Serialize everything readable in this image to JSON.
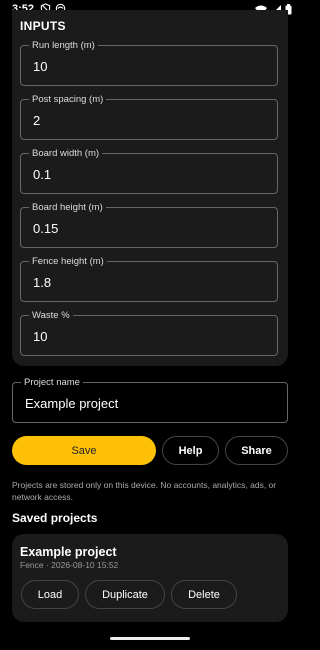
{
  "status_bar": {
    "time": "3:52"
  },
  "inputs": {
    "title": "INPUTS",
    "fields": [
      {
        "label": "Run length (m)",
        "value": "10"
      },
      {
        "label": "Post spacing (m)",
        "value": "2"
      },
      {
        "label": "Board width (m)",
        "value": "0.1"
      },
      {
        "label": "Board height (m)",
        "value": "0.15"
      },
      {
        "label": "Fence height (m)",
        "value": "1.8"
      },
      {
        "label": "Waste %",
        "value": "10"
      }
    ]
  },
  "project_name": {
    "label": "Project name",
    "value": "Example project"
  },
  "actions": {
    "save": "Save",
    "help": "Help",
    "share": "Share"
  },
  "privacy_note": "Projects are stored only on this device. No accounts, analytics, ads, or network access.",
  "saved_projects": {
    "heading": "Saved projects",
    "items": [
      {
        "name": "Example project",
        "meta": "Fence · 2026-08-10 15:52",
        "load": "Load",
        "duplicate": "Duplicate",
        "delete": "Delete"
      }
    ]
  },
  "colors": {
    "accent": "#ffc107",
    "background": "#000000",
    "card": "#1b1b1b"
  }
}
